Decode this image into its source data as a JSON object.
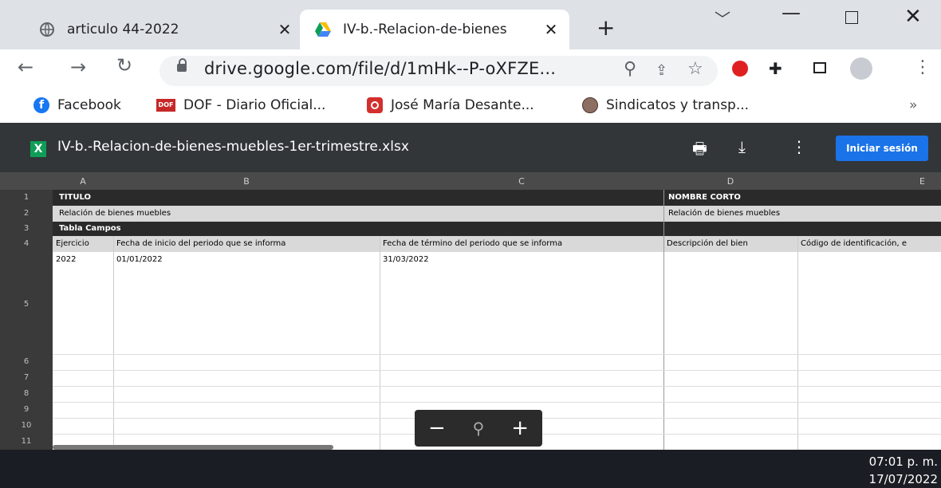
{
  "tabs": [
    {
      "title": "articulo 44-2022"
    },
    {
      "title": "IV-b.-Relacion-de-bienes"
    }
  ],
  "address": {
    "url": "drive.google.com/file/d/1mHk--P-oXFZE..."
  },
  "bookmarks": [
    {
      "label": "Facebook"
    },
    {
      "label": "DOF - Diario Oficial..."
    },
    {
      "label": "José María Desante..."
    },
    {
      "label": "Sindicatos y transp..."
    }
  ],
  "bookmarks_more": "»",
  "viewer": {
    "filename": "IV-b.-Relacion-de-bienes-muebles-1er-trimestre.xlsx",
    "signin_label": "Iniciar sesión"
  },
  "sheet": {
    "columns": [
      "A",
      "B",
      "C",
      "D",
      "E"
    ],
    "rows": [
      "1",
      "2",
      "3",
      "4",
      "5",
      "6",
      "7",
      "8",
      "9",
      "10",
      "11"
    ],
    "cells": {
      "titulo": "TÍTULO",
      "nombre_corto": "NOMBRE CORTO",
      "relacion_title": "Relación de bienes muebles",
      "relacion_short": "Relación de bienes muebles",
      "tabla_campos": "Tabla Campos",
      "h_ejercicio": "Ejercicio",
      "h_fecha_inicio": "Fecha de inicio del periodo que se informa",
      "h_fecha_termino": "Fecha de término del periodo que se informa",
      "h_descripcion": "Descripción del bien",
      "h_codigo": "Código de identificación, e",
      "v_ejercicio": "2022",
      "v_fecha_inicio": "01/01/2022",
      "v_fecha_termino": "31/03/2022"
    }
  },
  "taskbar": {
    "time": "07:01 p. m.",
    "date": "17/07/2022"
  }
}
